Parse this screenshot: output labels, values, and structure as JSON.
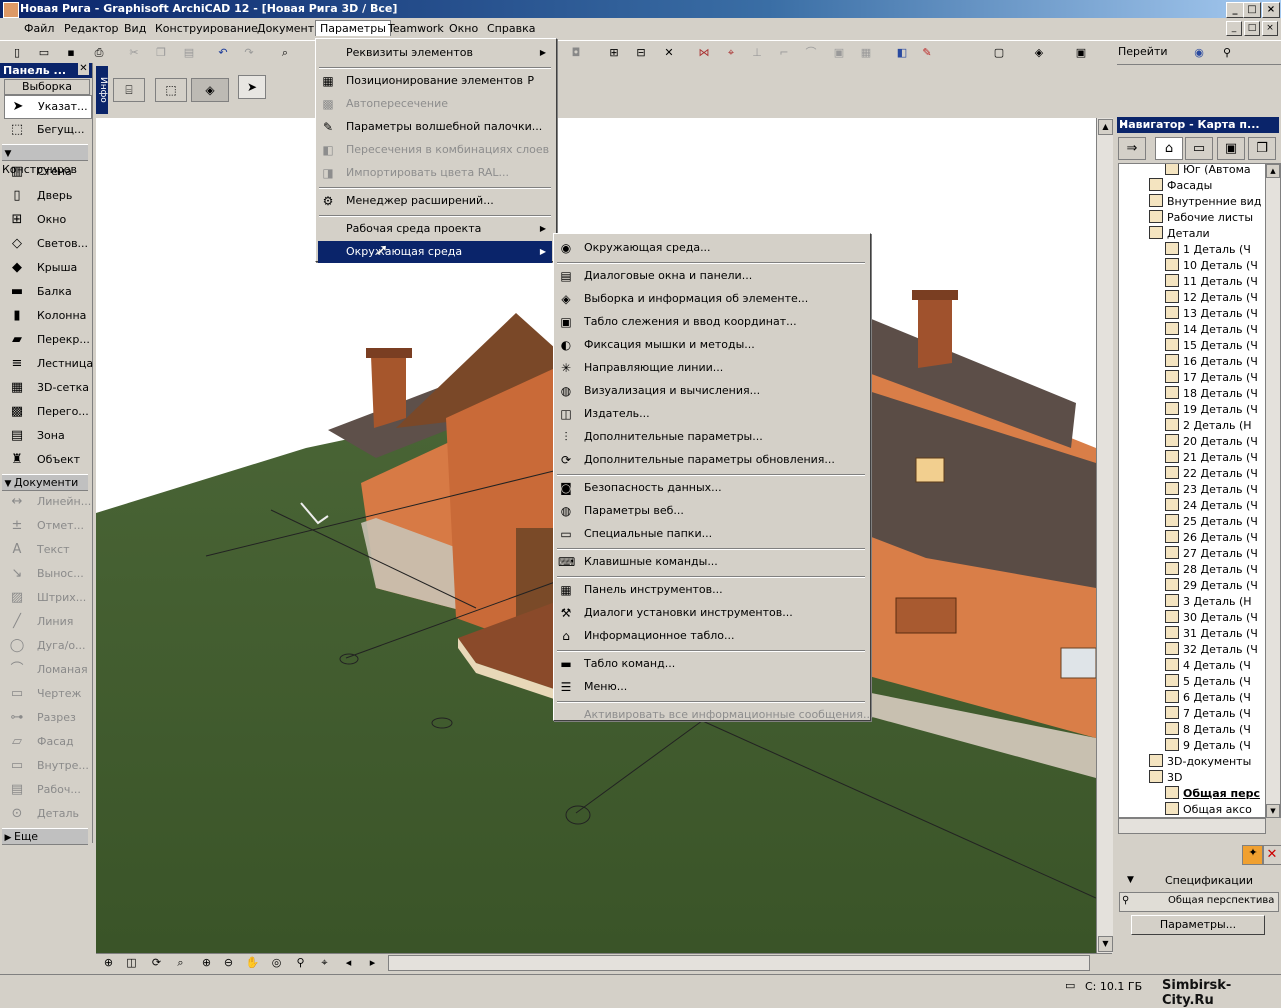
{
  "window": {
    "title": "Новая Рига - Graphisoft ArchiCAD 12 - [Новая Рига 3D / Все]",
    "minimize": "_",
    "maximize": "□",
    "close": "×"
  },
  "menubar": [
    "Файл",
    "Редактор",
    "Вид",
    "Конструирование",
    "Документ",
    "Параметры",
    "Teamwork",
    "Окно",
    "Справка"
  ],
  "toolbar": {
    "goto_label": "Перейти"
  },
  "palette": {
    "title": "Панель ...",
    "selection_label": "Выборка",
    "pointer_label": "Указат...",
    "marquee_label": "Бегущ...",
    "section_construct": "Конструиров",
    "construct_items": [
      "Стена",
      "Дверь",
      "Окно",
      "Светов...",
      "Крыша",
      "Балка",
      "Колонна",
      "Перекр...",
      "Лестница",
      "3D-сетка",
      "Перего...",
      "Зона",
      "Объект"
    ],
    "section_document": "Документи",
    "document_items": [
      "Линейн...",
      "Отмет...",
      "Текст",
      "Вынос...",
      "Штрих...",
      "Линия",
      "Дуга/о...",
      "Ломаная",
      "Чертеж",
      "Разрез",
      "Фасад",
      "Внутре...",
      "Рабоч...",
      "Деталь"
    ],
    "section_more": "Еще",
    "infobox_label": "Инфо"
  },
  "navigator": {
    "title": "Навигатор - Карта п...",
    "tree": [
      {
        "label": "Юг (Автома",
        "level": 3
      },
      {
        "label": "Фасады",
        "level": 2
      },
      {
        "label": "Внутренние вид",
        "level": 2
      },
      {
        "label": "Рабочие листы",
        "level": 2
      },
      {
        "label": "Детали",
        "level": 2
      },
      {
        "label": "1 Деталь (Ч",
        "level": 3
      },
      {
        "label": "10 Деталь (Ч",
        "level": 3
      },
      {
        "label": "11 Деталь (Ч",
        "level": 3
      },
      {
        "label": "12 Деталь (Ч",
        "level": 3
      },
      {
        "label": "13 Деталь (Ч",
        "level": 3
      },
      {
        "label": "14 Деталь (Ч",
        "level": 3
      },
      {
        "label": "15 Деталь (Ч",
        "level": 3
      },
      {
        "label": "16 Деталь (Ч",
        "level": 3
      },
      {
        "label": "17 Деталь (Ч",
        "level": 3
      },
      {
        "label": "18 Деталь (Ч",
        "level": 3
      },
      {
        "label": "19 Деталь (Ч",
        "level": 3
      },
      {
        "label": "2 Деталь (Н",
        "level": 3
      },
      {
        "label": "20 Деталь (Ч",
        "level": 3
      },
      {
        "label": "21 Деталь (Ч",
        "level": 3
      },
      {
        "label": "22 Деталь (Ч",
        "level": 3
      },
      {
        "label": "23 Деталь (Ч",
        "level": 3
      },
      {
        "label": "24 Деталь (Ч",
        "level": 3
      },
      {
        "label": "25 Деталь (Ч",
        "level": 3
      },
      {
        "label": "26 Деталь (Ч",
        "level": 3
      },
      {
        "label": "27 Деталь (Ч",
        "level": 3
      },
      {
        "label": "28 Деталь (Ч",
        "level": 3
      },
      {
        "label": "29 Деталь (Ч",
        "level": 3
      },
      {
        "label": "3 Деталь (Н",
        "level": 3
      },
      {
        "label": "30 Деталь (Ч",
        "level": 3
      },
      {
        "label": "31 Деталь (Ч",
        "level": 3
      },
      {
        "label": "32 Деталь (Ч",
        "level": 3
      },
      {
        "label": "4 Деталь (Ч",
        "level": 3
      },
      {
        "label": "5 Деталь (Ч",
        "level": 3
      },
      {
        "label": "6 Деталь (Ч",
        "level": 3
      },
      {
        "label": "7 Деталь (Ч",
        "level": 3
      },
      {
        "label": "8 Деталь (Ч",
        "level": 3
      },
      {
        "label": "9 Деталь (Ч",
        "level": 3
      },
      {
        "label": "3D-документы",
        "level": 2
      },
      {
        "label": "3D",
        "level": 2
      },
      {
        "label": "Общая перс",
        "level": 3
      },
      {
        "label": "Общая аксо",
        "level": 3
      }
    ],
    "specs_label": "Спецификации",
    "view_name": "Общая перспектива",
    "settings_button": "Параметры..."
  },
  "menu_options": {
    "items": [
      {
        "label": "Реквизиты элементов",
        "submenu": true,
        "disabled": false
      },
      {
        "sep": true
      },
      {
        "label": "Позиционирование элементов",
        "shortcut": "P",
        "disabled": false,
        "icon": "position-icon"
      },
      {
        "label": "Автопересечение",
        "disabled": true,
        "icon": "auto-intersect-icon"
      },
      {
        "label": "Параметры волшебной палочки...",
        "disabled": false,
        "icon": "magic-wand-icon"
      },
      {
        "label": "Пересечения в комбинациях слоев",
        "disabled": true,
        "icon": "layer-intersect-icon"
      },
      {
        "label": "Импортировать цвета RAL...",
        "disabled": true,
        "icon": "ral-icon"
      },
      {
        "sep": true
      },
      {
        "label": "Менеджер расширений...",
        "disabled": false,
        "icon": "addon-manager-icon"
      },
      {
        "sep": true
      },
      {
        "label": "Рабочая среда проекта",
        "submenu": true,
        "disabled": false
      },
      {
        "label": "Окружающая среда",
        "submenu": true,
        "disabled": false,
        "highlighted": true
      }
    ]
  },
  "menu_environment": {
    "items": [
      {
        "label": "Окружающая среда...",
        "icon": "environment-icon"
      },
      {
        "sep": true
      },
      {
        "label": "Диалоговые окна и панели...",
        "icon": "dialogs-icon"
      },
      {
        "label": "Выборка и информация об элементе...",
        "icon": "selection-info-icon"
      },
      {
        "label": "Табло слежения и ввод координат...",
        "icon": "tracker-icon"
      },
      {
        "label": "Фиксация мышки и методы...",
        "icon": "mouse-icon"
      },
      {
        "label": "Направляющие линии...",
        "icon": "guide-lines-icon"
      },
      {
        "label": "Визуализация и вычисления...",
        "icon": "imaging-icon"
      },
      {
        "label": "Издатель...",
        "icon": "publisher-icon"
      },
      {
        "label": "Дополнительные параметры...",
        "icon": "more-options-icon"
      },
      {
        "label": "Дополнительные параметры обновления...",
        "icon": "update-options-icon"
      },
      {
        "sep": true
      },
      {
        "label": "Безопасность данных...",
        "icon": "data-safety-icon"
      },
      {
        "label": "Параметры веб...",
        "icon": "web-icon"
      },
      {
        "label": "Специальные папки...",
        "icon": "special-folders-icon"
      },
      {
        "sep": true
      },
      {
        "label": "Клавишные команды...",
        "icon": "shortcuts-icon"
      },
      {
        "sep": true
      },
      {
        "label": "Панель инструментов...",
        "icon": "toolbox-icon"
      },
      {
        "label": "Диалоги установки инструментов...",
        "icon": "tool-settings-icon"
      },
      {
        "label": "Информационное табло...",
        "icon": "info-box-icon"
      },
      {
        "sep": true
      },
      {
        "label": "Табло команд...",
        "icon": "toolbars-icon"
      },
      {
        "label": "Меню...",
        "icon": "menus-icon"
      },
      {
        "sep": true
      },
      {
        "label": "Активировать все информационные сообщения...",
        "disabled": true
      }
    ]
  },
  "status": {
    "disk": "С: 10.1 ГБ",
    "watermark": "Simbirsk-City.Ru"
  },
  "colors": {
    "title_bar": "#0a246a",
    "menu_highlight": "#0a246a",
    "grass": "#3f5a2d",
    "walls": "#d77a45",
    "roof": "#5a4d47"
  }
}
